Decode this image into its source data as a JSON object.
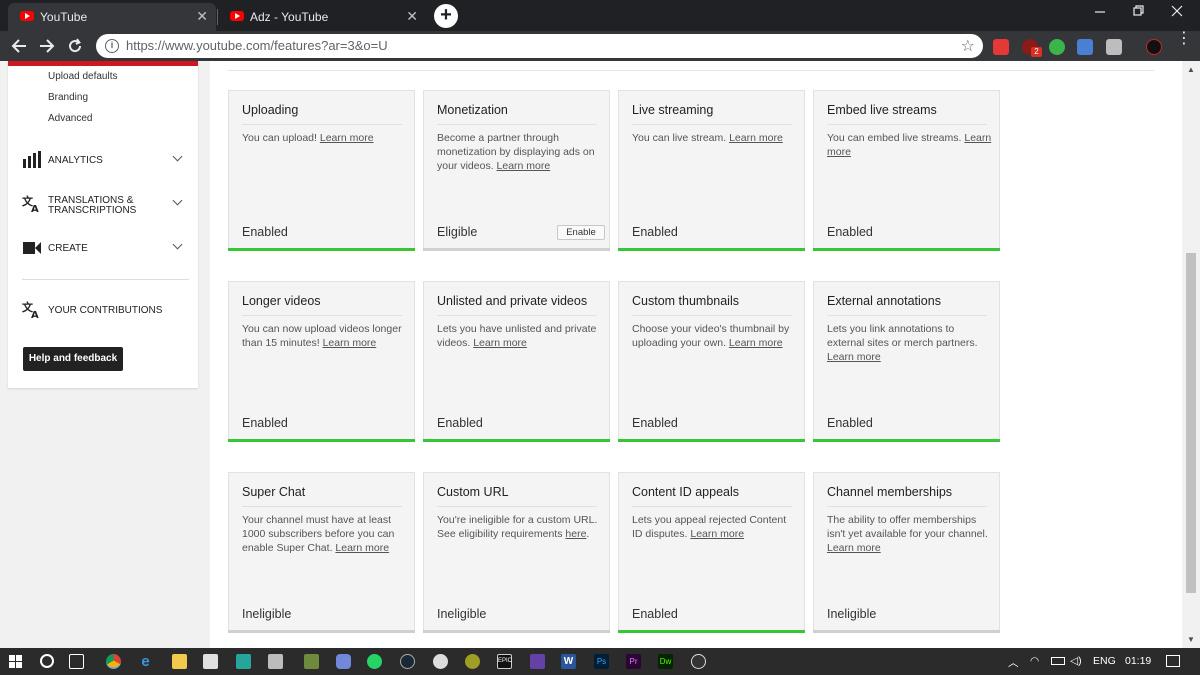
{
  "browser": {
    "tabs": [
      {
        "title": "YouTube",
        "active": true
      },
      {
        "title": "Adz - YouTube",
        "active": false
      }
    ],
    "new_tab_symbol": "+",
    "close_symbol": "✕",
    "url": "https://www.youtube.com/features?ar=3&o=U",
    "extension_badge": "2"
  },
  "sidebar": {
    "sub_items": [
      "Upload defaults",
      "Branding",
      "Advanced"
    ],
    "sections": [
      {
        "label": "ANALYTICS",
        "icon": "bar-chart-icon"
      },
      {
        "label_line1": "TRANSLATIONS &",
        "label_line2": "TRANSCRIPTIONS",
        "icon": "translate-icon"
      },
      {
        "label": "CREATE",
        "icon": "video-camera-icon"
      }
    ],
    "contributions": {
      "label": "YOUR CONTRIBUTIONS",
      "icon": "translate-icon"
    },
    "help_button": "Help and feedback"
  },
  "features": [
    {
      "title": "Uploading",
      "desc": "You can upload! ",
      "link": "Learn more",
      "status": "Enabled",
      "enabled": true
    },
    {
      "title": "Monetization",
      "desc": "Become a partner through monetization by displaying ads on your videos. ",
      "link": "Learn more",
      "status": "Eligible",
      "enabled": false,
      "button": "Enable"
    },
    {
      "title": "Live streaming",
      "desc": "You can live stream. ",
      "link": "Learn more",
      "status": "Enabled",
      "enabled": true
    },
    {
      "title": "Embed live streams",
      "desc": "You can embed live streams. ",
      "link": "Learn more",
      "status": "Enabled",
      "enabled": true
    },
    {
      "title": "Longer videos",
      "desc": "You can now upload videos longer than 15 minutes! ",
      "link": "Learn more",
      "status": "Enabled",
      "enabled": true
    },
    {
      "title": "Unlisted and private videos",
      "desc": "Lets you have unlisted and private videos. ",
      "link": "Learn more",
      "status": "Enabled",
      "enabled": true
    },
    {
      "title": "Custom thumbnails",
      "desc": "Choose your video's thumbnail by uploading your own. ",
      "link": "Learn more",
      "status": "Enabled",
      "enabled": true
    },
    {
      "title": "External annotations",
      "desc": "Lets you link annotations to external sites or merch partners. ",
      "link": "Learn more",
      "status": "Enabled",
      "enabled": true
    },
    {
      "title": "Super Chat",
      "desc": "Your channel must have at least 1000 subscribers before you can enable Super Chat. ",
      "link": "Learn more",
      "status": "Ineligible",
      "enabled": false
    },
    {
      "title": "Custom URL",
      "desc": "You're ineligible for a custom URL. See eligibility requirements ",
      "link": "here",
      "desc_after": ".",
      "status": "Ineligible",
      "enabled": false
    },
    {
      "title": "Content ID appeals",
      "desc": "Lets you appeal rejected Content ID disputes. ",
      "link": "Learn more",
      "status": "Enabled",
      "enabled": true
    },
    {
      "title": "Channel memberships",
      "desc": "The ability to offer memberships isn't yet available for your channel. ",
      "link": "Learn more",
      "status": "Ineligible",
      "enabled": false
    }
  ],
  "taskbar": {
    "language": "ENG",
    "time": "01:19",
    "icons": [
      "start-icon",
      "search-circle-icon",
      "task-view-icon",
      "chrome-icon",
      "edge-icon",
      "explorer-icon",
      "store-icon",
      "app-icon",
      "mail-icon",
      "minecraft-icon",
      "discord-icon",
      "whatsapp-icon",
      "steam-icon",
      "app-icon",
      "app-icon",
      "epic-games-icon",
      "twitch-icon",
      "word-icon",
      "photoshop-icon",
      "premiere-icon",
      "dreamweaver-icon",
      "obs-icon"
    ],
    "app_labels": {
      "epic": "EPIC",
      "word": "W",
      "ps": "Ps",
      "pr": "Pr",
      "dw": "Dw"
    }
  },
  "colors": {
    "enabled_bar": "#36c636",
    "disabled_bar": "#d0d0d0",
    "youtube_red": "#ff0000",
    "sidebar_accent": "#cc181e"
  }
}
